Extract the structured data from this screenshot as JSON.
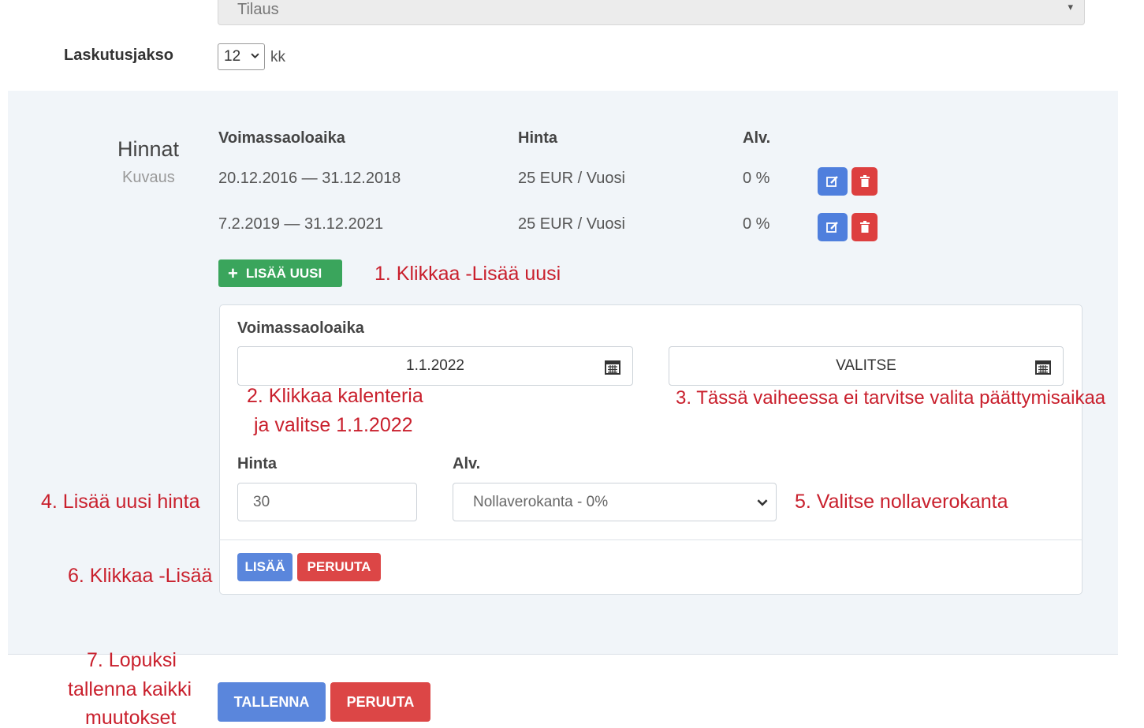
{
  "top": {
    "select_value": "Tilaus",
    "billing_period_label": "Laskutusjakso",
    "billing_period_value": "12",
    "billing_period_unit": "kk"
  },
  "prices": {
    "title": "Hinnat",
    "subtitle": "Kuvaus",
    "headers": {
      "validity": "Voimassaoloaika",
      "price": "Hinta",
      "vat": "Alv."
    },
    "rows": [
      {
        "validity": "20.12.2016 — 31.12.2018",
        "price": "25 EUR / Vuosi",
        "vat": "0 %"
      },
      {
        "validity": "7.2.2019 — 31.12.2021",
        "price": "25 EUR / Vuosi",
        "vat": "0 %"
      }
    ],
    "add_new_label": "LISÄÄ UUSI"
  },
  "form": {
    "validity_label": "Voimassaoloaika",
    "start_date": "1.1.2022",
    "end_date_placeholder": "VALITSE",
    "price_label": "Hinta",
    "price_value": "30",
    "vat_label": "Alv.",
    "vat_value": "Nollaverokanta - 0%",
    "add_button": "LISÄÄ",
    "cancel_button": "PERUUTA"
  },
  "footer": {
    "save_button": "TALLENNA",
    "cancel_button": "PERUUTA"
  },
  "annotations": {
    "step1": "1. Klikkaa -Lisää uusi",
    "step2_line1": "2. Klikkaa kalenteria",
    "step2_line2": "ja valitse 1.1.2022",
    "step3": "3. Tässä vaiheessa ei tarvitse valita päättymisaikaa",
    "step4": "4. Lisää uusi hinta",
    "step5": "5. Valitse nollaverokanta",
    "step6": "6. Klikkaa -Lisää",
    "step7_line1": "7. Lopuksi",
    "step7_line2": "tallenna kaikki",
    "step7_line3": "muutokset"
  },
  "colors": {
    "annotation_red": "#c9202d",
    "success_green": "#3aa55c",
    "primary_blue": "#5a86dc",
    "danger_red": "#dc4646",
    "panel_bg": "#f1f5f9"
  },
  "icons": {
    "edit": "edit-icon",
    "delete": "trash-icon",
    "calendar": "calendar-icon",
    "add": "plus-icon",
    "dropdown": "chevron-down-icon"
  }
}
